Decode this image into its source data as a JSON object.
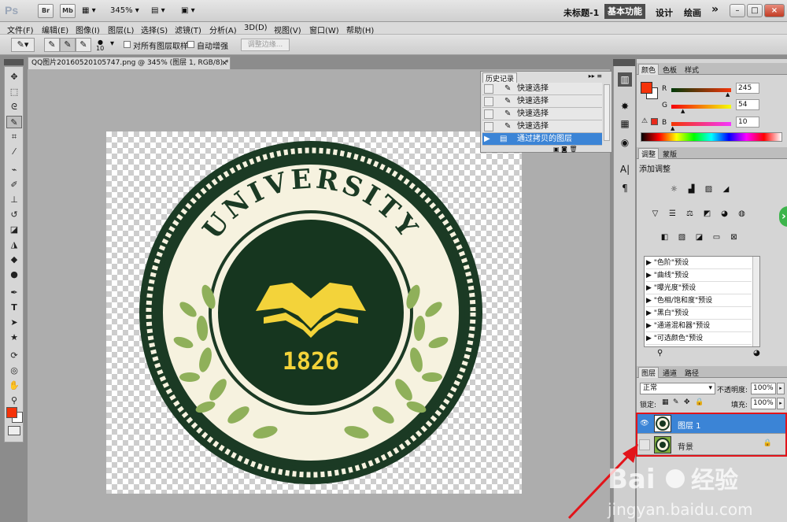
{
  "app": {
    "logo": "Ps",
    "bridge_label": "Br",
    "minibridge_label": "Mb",
    "zoom": "345%",
    "doc_title": "未标题-1",
    "workspaces": [
      "基本功能",
      "设计",
      "绘画"
    ],
    "more": "»",
    "window_controls": [
      "–",
      "□",
      "×"
    ]
  },
  "menu": [
    "文件(F)",
    "编辑(E)",
    "图像(I)",
    "图层(L)",
    "选择(S)",
    "滤镜(T)",
    "分析(A)",
    "3D(D)",
    "视图(V)",
    "窗口(W)",
    "帮助(H)"
  ],
  "options": {
    "brush_size": "10",
    "sample_all_layers": "对所有图层取样",
    "auto_enhance": "自动增强",
    "refine_edge": "调整边缘..."
  },
  "document": {
    "tab_label": "QQ图片20160520105747.png @ 345% (图层 1, RGB/8) *",
    "emblem": {
      "arc_text": "UNIVERSITY",
      "year": "1826"
    }
  },
  "history": {
    "title": "历史记录",
    "rows": [
      "快速选择",
      "快速选择",
      "快速选择",
      "快速选择",
      "通过拷贝的图层"
    ],
    "selected_index": 4
  },
  "color_panel": {
    "tabs": [
      "颜色",
      "色板",
      "样式"
    ],
    "channels": [
      {
        "label": "R",
        "value": "245",
        "fraction": 0.96
      },
      {
        "label": "G",
        "value": "54",
        "fraction": 0.21
      },
      {
        "label": "B",
        "value": "10",
        "fraction": 0.04
      }
    ],
    "foreground": "#f5360a",
    "background": "#ffffff"
  },
  "adjustments": {
    "tabs": [
      "调整",
      "蒙版"
    ],
    "title": "添加调整",
    "presets": [
      "\"色阶\"预设",
      "\"曲线\"预设",
      "\"曝光度\"预设",
      "\"色相/饱和度\"预设",
      "\"黑白\"预设",
      "\"通道混和器\"预设",
      "\"可选颜色\"预设"
    ]
  },
  "layers": {
    "tabs": [
      "图层",
      "通道",
      "路径"
    ],
    "blend_mode": "正常",
    "opacity_label": "不透明度:",
    "opacity": "100%",
    "lock_label": "锁定:",
    "fill_label": "填充:",
    "fill": "100%",
    "items": [
      {
        "name": "图层 1",
        "selected": true
      },
      {
        "name": "背景",
        "selected": false
      }
    ]
  },
  "watermark": {
    "brand": "Bai",
    "brand_cn": "经验",
    "url": "jingyan.baidu.com"
  },
  "colors": {
    "accent_select": "#3b84d6",
    "annotation_red": "#e2141a",
    "emblem_dark": "#16361f",
    "emblem_cream": "#f6f2df",
    "emblem_yellow": "#f3d33a",
    "emblem_leaf": "#8fb05a"
  }
}
